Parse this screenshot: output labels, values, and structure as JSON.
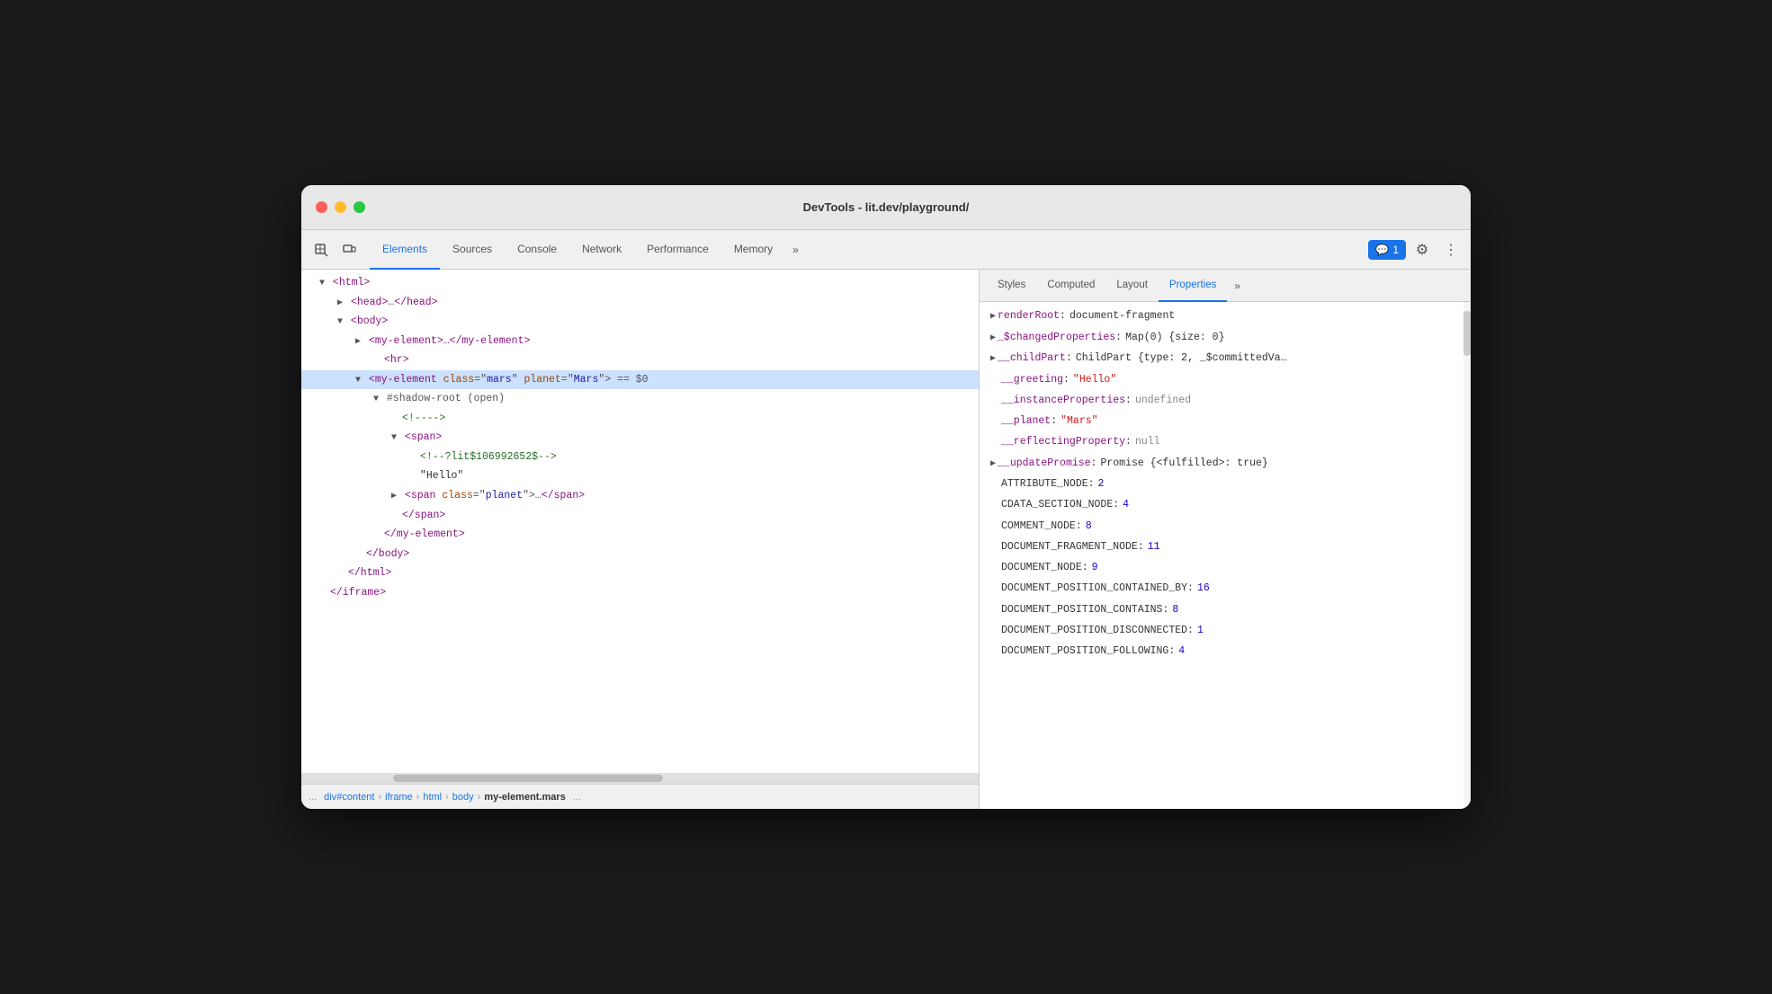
{
  "window": {
    "title": "DevTools - lit.dev/playground/"
  },
  "tabs": {
    "main": [
      {
        "label": "Elements",
        "active": true
      },
      {
        "label": "Sources"
      },
      {
        "label": "Console"
      },
      {
        "label": "Network"
      },
      {
        "label": "Performance"
      },
      {
        "label": "Memory"
      },
      {
        "label": ">>"
      }
    ],
    "right": [
      {
        "label": "Styles"
      },
      {
        "label": "Computed"
      },
      {
        "label": "Layout"
      },
      {
        "label": "Properties",
        "active": true
      },
      {
        "label": ">>"
      }
    ]
  },
  "notification": {
    "icon": "💬",
    "count": "1"
  },
  "dom": {
    "lines": [
      {
        "indent": 1,
        "content": "▼ <html>",
        "type": "tag"
      },
      {
        "indent": 2,
        "content": "▶ <head>…</head>",
        "type": "tag"
      },
      {
        "indent": 2,
        "content": "▼ <body>",
        "type": "tag"
      },
      {
        "indent": 3,
        "content": "▶ <my-element>…</my-element>",
        "type": "tag"
      },
      {
        "indent": 4,
        "content": "<hr>",
        "type": "tag"
      },
      {
        "indent": 3,
        "content": "selected",
        "type": "selected"
      },
      {
        "indent": 4,
        "content": "▼ #shadow-root (open)",
        "type": "shadow"
      },
      {
        "indent": 5,
        "content": "<!---->",
        "type": "comment"
      },
      {
        "indent": 5,
        "content": "▼ <span>",
        "type": "tag"
      },
      {
        "indent": 6,
        "content": "<!--?lit$106992652$-->",
        "type": "comment"
      },
      {
        "indent": 6,
        "content": "\"Hello\"",
        "type": "text"
      },
      {
        "indent": 5,
        "content": "▶ <span class=\"planet\">…</span>",
        "type": "tag"
      },
      {
        "indent": 5,
        "content": "</span>",
        "type": "tag"
      },
      {
        "indent": 4,
        "content": "</my-element>",
        "type": "tag"
      },
      {
        "indent": 3,
        "content": "</body>",
        "type": "tag"
      },
      {
        "indent": 2,
        "content": "</html>",
        "type": "tag"
      },
      {
        "indent": 1,
        "content": "</iframe>",
        "type": "tag"
      }
    ]
  },
  "breadcrumb": {
    "dots": "...",
    "items": [
      {
        "label": "div#content"
      },
      {
        "label": "iframe"
      },
      {
        "label": "html"
      },
      {
        "label": "body"
      },
      {
        "label": "my-element.mars"
      }
    ],
    "more": "..."
  },
  "properties": [
    {
      "expand": true,
      "key": "renderRoot",
      "colon": ":",
      "value": "document-fragment",
      "valueType": "obj"
    },
    {
      "expand": true,
      "key": "_$changedProperties",
      "colon": ":",
      "value": "Map(0) {size: 0}",
      "valueType": "obj"
    },
    {
      "expand": true,
      "key": "__childPart",
      "colon": ":",
      "value": "ChildPart {type: 2, _$committedVa…",
      "valueType": "obj"
    },
    {
      "expand": false,
      "key": "__greeting",
      "colon": ":",
      "value": "\"Hello\"",
      "valueType": "str"
    },
    {
      "expand": false,
      "key": "__instanceProperties",
      "colon": ":",
      "value": "undefined",
      "valueType": "null"
    },
    {
      "expand": false,
      "key": "__planet",
      "colon": ":",
      "value": "\"Mars\"",
      "valueType": "str"
    },
    {
      "expand": false,
      "key": "__reflectingProperty",
      "colon": ":",
      "value": "null",
      "valueType": "null"
    },
    {
      "expand": true,
      "key": "__updatePromise",
      "colon": ":",
      "value": "Promise {<fulfilled>: true}",
      "valueType": "obj"
    },
    {
      "expand": false,
      "key": "ATTRIBUTE_NODE",
      "colon": ":",
      "value": "2",
      "valueType": "num"
    },
    {
      "expand": false,
      "key": "CDATA_SECTION_NODE",
      "colon": ":",
      "value": "4",
      "valueType": "num"
    },
    {
      "expand": false,
      "key": "COMMENT_NODE",
      "colon": ":",
      "value": "8",
      "valueType": "num"
    },
    {
      "expand": false,
      "key": "DOCUMENT_FRAGMENT_NODE",
      "colon": ":",
      "value": "11",
      "valueType": "num"
    },
    {
      "expand": false,
      "key": "DOCUMENT_NODE",
      "colon": ":",
      "value": "9",
      "valueType": "num"
    },
    {
      "expand": false,
      "key": "DOCUMENT_POSITION_CONTAINED_BY",
      "colon": ":",
      "value": "16",
      "valueType": "num"
    },
    {
      "expand": false,
      "key": "DOCUMENT_POSITION_CONTAINS",
      "colon": ":",
      "value": "8",
      "valueType": "num"
    },
    {
      "expand": false,
      "key": "DOCUMENT_POSITION_DISCONNECTED",
      "colon": ":",
      "value": "1",
      "valueType": "num"
    },
    {
      "expand": false,
      "key": "DOCUMENT_POSITION_FOLLOWING",
      "colon": ":",
      "value": "4",
      "valueType": "num"
    }
  ],
  "colors": {
    "tagColor": "#881280",
    "attrName": "#994500",
    "attrValue": "#1a1aa6",
    "comment": "#236e25",
    "activeTab": "#1a73e8",
    "propKey": "#881280",
    "propStr": "#c41a16",
    "propNum": "#1c00cf"
  }
}
